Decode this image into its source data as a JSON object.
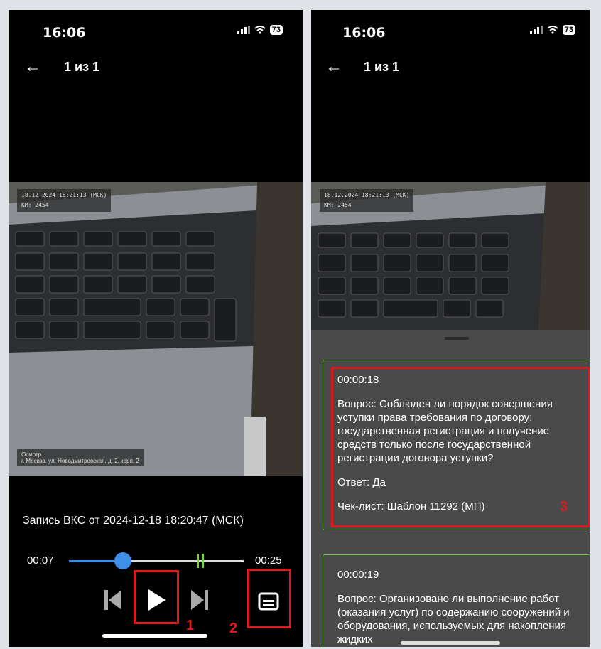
{
  "status": {
    "time": "16:06",
    "battery": "73"
  },
  "nav": {
    "title": "1 из 1"
  },
  "video": {
    "overlay_datetime": "18.12.2024 18:21:13 (МСК)",
    "overlay_km": "КМ: 2454",
    "overlay_place_1": "Осмотр",
    "overlay_place_2": "г. Москва, ул. Новодмитровская, д. 2, корп. 2"
  },
  "player": {
    "recording_title": "Запись ВКС от 2024-12-18 18:20:47 (МСК)",
    "current_time": "00:07",
    "total_time": "00:25",
    "progress_fraction": 0.31
  },
  "annotations": {
    "num1": "1",
    "num2": "2",
    "num3": "3"
  },
  "cards": [
    {
      "timecode": "00:00:18",
      "question": "Вопрос: Соблюден ли порядок совершения уступки права требования по договору: государственная регистрация и получение средств только после государственной регистрации договора уступки?",
      "answer": "Ответ: Да",
      "checklist": "Чек-лист: Шаблон 11292 (МП)"
    },
    {
      "timecode": "00:00:19",
      "question": "Вопрос: Организовано ли выполнение работ (оказания услуг) по содержанию сооружений и оборудования, используемых для накопления жидких"
    }
  ],
  "colors": {
    "accent": "#3d8fe8",
    "marker": "#7bd14b",
    "annotation": "#e0191b",
    "card_border": "#6dc24b"
  }
}
